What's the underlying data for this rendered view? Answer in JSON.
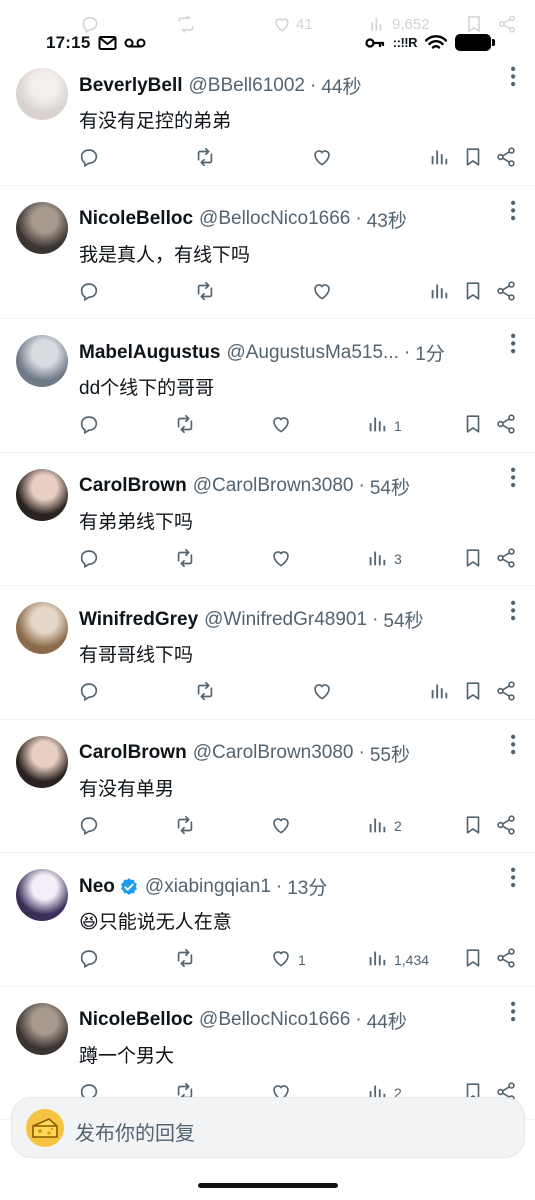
{
  "ghost_row": {
    "likes": "41",
    "views": "9,652"
  },
  "status_bar": {
    "time": "17:15",
    "signal_text": "::!!R"
  },
  "tweets": [
    {
      "name": "BeverlyBell",
      "handle": "@BBell61002",
      "ago": "44秒",
      "text": "有没有足控的弟弟",
      "verified": false,
      "avatar_colors": [
        "#d9d2cf",
        "#f3efec"
      ],
      "replies": "",
      "reposts": "",
      "likes": "",
      "views": ""
    },
    {
      "name": "NicoleBelloc",
      "handle": "@BellocNico1666",
      "ago": "43秒",
      "text": "我是真人，有线下吗",
      "verified": false,
      "avatar_colors": [
        "#3b3532",
        "#a89a8e"
      ],
      "replies": "",
      "reposts": "",
      "likes": "",
      "views": ""
    },
    {
      "name": "MabelAugustus",
      "handle": "@AugustusMa515...",
      "ago": "1分",
      "text": "dd个线下的哥哥",
      "verified": false,
      "avatar_colors": [
        "#6f7a86",
        "#d8dde2"
      ],
      "replies": "",
      "reposts": "",
      "likes": "",
      "views": "1"
    },
    {
      "name": "CarolBrown",
      "handle": "@CarolBrown3080",
      "ago": "54秒",
      "text": "有弟弟线下吗",
      "verified": false,
      "avatar_colors": [
        "#2a2220",
        "#e8cfc2"
      ],
      "replies": "",
      "reposts": "",
      "likes": "",
      "views": "3"
    },
    {
      "name": "WinifredGrey",
      "handle": "@WinifredGr48901",
      "ago": "54秒",
      "text": "有哥哥线下吗",
      "verified": false,
      "avatar_colors": [
        "#8a6a4a",
        "#e6d8c8"
      ],
      "replies": "",
      "reposts": "",
      "likes": "",
      "views": ""
    },
    {
      "name": "CarolBrown",
      "handle": "@CarolBrown3080",
      "ago": "55秒",
      "text": "有没有单男",
      "verified": false,
      "avatar_colors": [
        "#2a2220",
        "#e8cfc2"
      ],
      "replies": "",
      "reposts": "",
      "likes": "",
      "views": "2"
    },
    {
      "name": "Neo",
      "handle": "@xiabingqian1",
      "ago": "13分",
      "text": "😆只能说无人在意",
      "verified": true,
      "avatar_colors": [
        "#3b2f5a",
        "#f4eef8"
      ],
      "replies": "",
      "reposts": "",
      "likes": "1",
      "views": "1,434"
    },
    {
      "name": "NicoleBelloc",
      "handle": "@BellocNico1666",
      "ago": "44秒",
      "text": "蹲一个男大",
      "verified": false,
      "avatar_colors": [
        "#3b3532",
        "#a89a8e"
      ],
      "replies": "",
      "reposts": "",
      "likes": "",
      "views": "2"
    }
  ],
  "reply_bar": {
    "placeholder": "发布你的回复"
  },
  "colors": {
    "text": "#0f1419",
    "muted": "#536471",
    "verified": "#1d9bf0",
    "divider": "#eff3f4"
  }
}
